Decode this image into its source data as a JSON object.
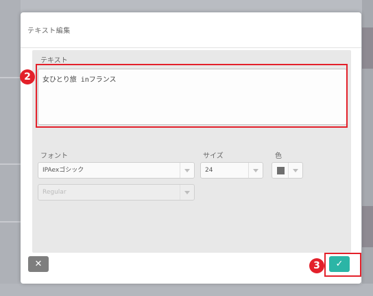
{
  "dialog": {
    "title": "テキスト編集"
  },
  "form": {
    "text_label": "テキスト",
    "text_value": "女ひとり旅 inフランス",
    "font_label": "フォント",
    "font_value": "IPAexゴシック",
    "size_label": "サイズ",
    "size_value": "24",
    "color_label": "色",
    "color_value": "#6f6f6f",
    "weight_value": "Regular"
  },
  "buttons": {
    "cancel_glyph": "✕",
    "ok_glyph": "✓"
  },
  "annotations": {
    "step_2": "2",
    "step_3": "3",
    "color": "#e3202a"
  }
}
